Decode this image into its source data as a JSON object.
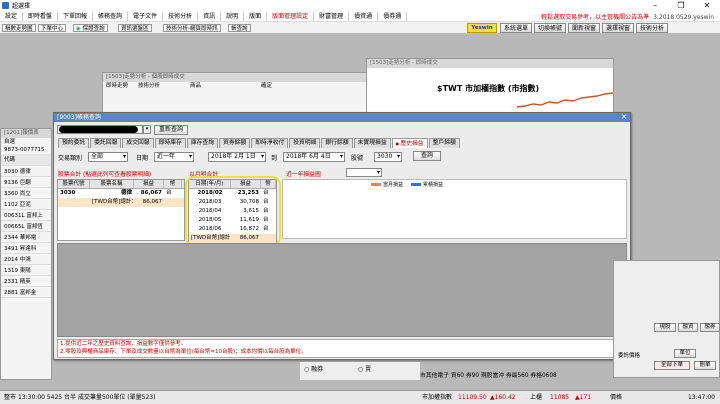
{
  "window": {
    "title": "超選擇",
    "version": "3.2018.0529.yeswin"
  },
  "menu": {
    "items": [
      "設定",
      "即時看盤",
      "下單回報",
      "帳務查詢",
      "電子文件",
      "技術分析",
      "資訊",
      "說明",
      "版面",
      "版面管理設定",
      "財富管理",
      "債資通",
      "債券通"
    ],
    "highlight_index": 9,
    "notice": "輕鬆選取交易參考，以主管機關公告為準"
  },
  "toolbar": {
    "left_buttons": [
      "損數走勢圖",
      "下單中心",
      "保證查詢",
      "資訊選盤區",
      "技術分析-網頁即時訊",
      "帳查詢"
    ],
    "logo": "Yeswin",
    "right_buttons": [
      "系統選單",
      "切換帳號",
      "聞新視窗",
      "選擇視窗",
      "技術分析"
    ]
  },
  "bg_windows": {
    "window_a_caption": "[1503]走勢分析 - 個股即時成交",
    "window_a_tabs": [
      "即時走勢",
      "技術分析",
      "商品",
      "確定"
    ],
    "stock_caption": "[1503]走勢分析 - 即時成交",
    "stock_title": "$TWT 市加權指數 (市指數)",
    "left_caption": "[1201]報價表",
    "left_headers": [
      "自選",
      "代碼"
    ],
    "left_sub": "9873-0077715",
    "left_codes": [
      "3030",
      "9136",
      "3360",
      "1102",
      "00631L",
      "00665L",
      "2344",
      "3491",
      "2014",
      "1319",
      "2331",
      "2881"
    ],
    "left_names": [
      "德律",
      "巨翻",
      "尚立",
      "亞泥",
      "富邦上",
      "富邦恆",
      "華邦電",
      "昇達科",
      "中鴻",
      "東陽",
      "精英",
      "富邦金"
    ]
  },
  "dialog": {
    "caption": "[9003]帳務查詢",
    "requery_button": "重新查詢",
    "tabs": [
      "預約委託",
      "委託回報",
      "成交回報",
      "即時庫存",
      "庫存查詢",
      "資券餘額",
      "即時淨收付",
      "投資明細",
      "銀行餘額",
      "未實現損益",
      "歷史損益",
      "整戶餘額"
    ],
    "active_tab": 10,
    "filters": {
      "type_label": "交易類別",
      "type_value": "全部",
      "date_label": "日期",
      "period_value": "近一年",
      "from_value": "2018年 2月 1日",
      "to_label": "到",
      "to_value": "2018年 6月 4日",
      "stock_label": "股號",
      "stock_value": "3030",
      "query_button": "查詢"
    },
    "sections": {
      "by_stock": "股票合計 (點選此列可查看股票明細)",
      "by_month": "以月明合計",
      "chart_title": "近一年損益圖"
    },
    "grid_stock": {
      "headers": [
        "股票代號",
        "股票名稱",
        "損益",
        "幣"
      ],
      "rows": [
        [
          "3030",
          "德律",
          "86,067",
          "台"
        ]
      ],
      "total": [
        "",
        "[TWD台幣]總計：",
        "86,067",
        ""
      ]
    },
    "grid_month": {
      "headers": [
        "日期(年/月)",
        "損益",
        "幣"
      ],
      "rows": [
        [
          "2018/02",
          "23,253",
          "台"
        ],
        [
          "2018/03",
          "30,708",
          "台"
        ],
        [
          "2018/04",
          "3,615",
          "台"
        ],
        [
          "2018/05",
          "11,619",
          "台"
        ],
        [
          "2018/06",
          "16,872",
          "台"
        ]
      ],
      "total": [
        "[TWD台幣]總計：",
        "86,067",
        ""
      ]
    },
    "chart_legend": [
      "當月損益",
      "累積損益"
    ],
    "notes": [
      "1.提供近二年之歷史資料查詢，損益數字僅供參考。",
      "2.零股及興櫃商品庫存、下單及成交數量以台幣為單位(每台幣=10台股)；成本均價以每台股為單位。"
    ]
  },
  "order_panel": {
    "buttons": [
      "現股",
      "融資",
      "融券",
      "單位",
      "全部下單",
      "刪單"
    ],
    "label": "委託價格",
    "radio_a": "融券",
    "radio_b": "賣"
  },
  "quote": "市其他電子 資60 券90 現股當沖 券最560 券格0608",
  "status": {
    "left": "整市",
    "time_info": "13:30:00 5425 台半 成交筆量500單位 (單量523)",
    "index_label": "市加權指數",
    "index_value": "11109.50",
    "index_change": "▲160.42",
    "otc_label": "上櫃",
    "otc_value": "11085",
    "otc_change": "▲171",
    "extra": "價格",
    "clock": "13:47:00"
  },
  "colors": {
    "accent_red": "#cc0000",
    "highlight_ring": "#f0e030",
    "legend_orange": "#e88a3a",
    "legend_blue": "#3a6fd0"
  }
}
